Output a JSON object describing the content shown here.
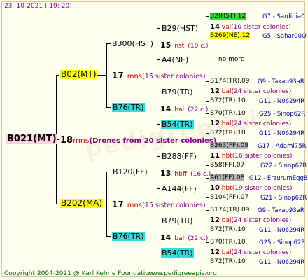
{
  "date": "23- 10-2021 ( 19: 20)",
  "footer_copyright": "Copyright 2004-2021 @ Karl Kehrle Foundation",
  "footer_site": "www.pedigreeapis.org",
  "watermark": "pedigreeapis",
  "root": {
    "label": "B021(MT)",
    "n": "18",
    "mark": "mns",
    "note": "(Drones from 20 sister colonies)"
  },
  "gen1": [
    {
      "label": "B02(MT)",
      "n": "17",
      "mark": "mns",
      "note": "(15 sister colonies)"
    },
    {
      "label": "B202(MA)",
      "n": "17",
      "mark": "mns",
      "note": "(15 sister colonies)"
    }
  ],
  "gen2": [
    {
      "label": "B300(HST)",
      "n": "15",
      "mark": "nst",
      "note": "(10 c.)"
    },
    {
      "label": "B76(TR)",
      "n": "14",
      "mark": "bal",
      "note": "(22 c.)"
    },
    {
      "label": "B120(FF)",
      "n": "13",
      "mark": "hbff",
      "note": "(16 c.)"
    },
    {
      "label": "B76(TR)",
      "n": "14",
      "mark": "bal",
      "note": "(22 c.)"
    }
  ],
  "gen3": [
    {
      "label": "B29(HST)"
    },
    {
      "label": "A4(NE)"
    },
    {
      "label": "B79(TR)",
      "n": "14",
      "mark": "bal",
      "note": "(22 c.)"
    },
    {
      "label": "B54(TR)"
    },
    {
      "label": "B288(FF)",
      "n": "13",
      "mark": "hbff",
      "note": "(16 c.)"
    },
    {
      "label": "A144(FF)"
    },
    {
      "label": "B79(TR)",
      "n": "14",
      "mark": "bal",
      "note": "(22 c.)"
    },
    {
      "label": "B54(TR)"
    }
  ],
  "gen4": [
    {
      "label": "B2(HST).12",
      "info": "G7 - Sardinia0"
    },
    {
      "n": "14",
      "mark": "val",
      "note": "(10 sister colonies)"
    },
    {
      "label": "B269(NE).12",
      "info": "G5 - Sahar00Q"
    },
    {
      "label": "no more"
    },
    {
      "label": "B174(TR).09",
      "info": "G9 - Takab93aR"
    },
    {
      "n": "12",
      "mark": "bal",
      "note": "(24 sister colonies)"
    },
    {
      "label": "B72(TR).10",
      "info": "G11 - N06294R"
    },
    {
      "label": "B70(TR).10",
      "info": "G25 - Sinop62R"
    },
    {
      "n": "12",
      "mark": "bal",
      "note": "(24 sister colonies)"
    },
    {
      "label": "B72(TR).10",
      "info": "G11 - N06294R"
    },
    {
      "label": "B263(FF).09",
      "info": "G17 - Adami75R"
    },
    {
      "n": "11",
      "mark": "hbt",
      "note": "(16 sister colonies)"
    },
    {
      "label": "B58(FF).07",
      "info": "G22 - Sinop62R"
    },
    {
      "label": "A61(FF).08",
      "info": "G12 - ErzurumEgg8"
    },
    {
      "n": "10",
      "mark": "hbt",
      "note": "(19 sister colonies)"
    },
    {
      "label": "B104(FF).07",
      "info": "G21 - Sinop62R"
    },
    {
      "label": "B174(TR).09",
      "info": "G9 - Takab93aR"
    },
    {
      "n": "12",
      "mark": "bal",
      "note": "(24 sister colonies)"
    },
    {
      "label": "B72(TR).10",
      "info": "G11 - N06294R"
    },
    {
      "label": "B70(TR).10",
      "info": "G25 - Sinop62R"
    },
    {
      "n": "12",
      "mark": "bal",
      "note": "(24 sister colonies)"
    },
    {
      "label": "B72(TR).10",
      "info": "G11 - N06294R"
    }
  ]
}
